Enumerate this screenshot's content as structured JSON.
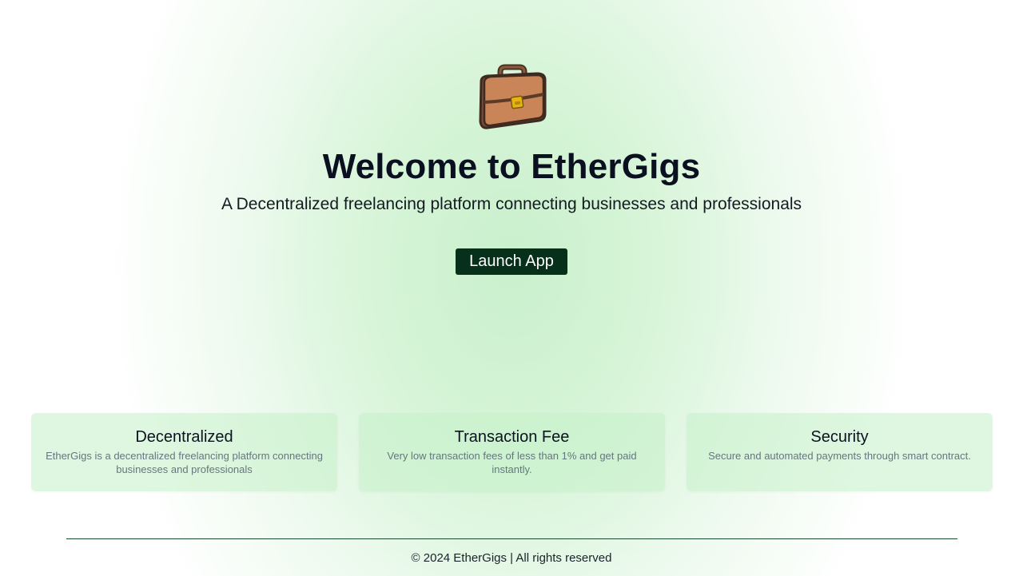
{
  "hero": {
    "logo_icon": "briefcase-icon",
    "title": "Welcome to EtherGigs",
    "subtitle": "A Decentralized freelancing platform connecting businesses and professionals",
    "launch_label": "Launch App"
  },
  "features": [
    {
      "title": "Decentralized",
      "text": "EtherGigs is a decentralized freelancing platform connecting businesses and professionals"
    },
    {
      "title": "Transaction Fee",
      "text": "Very low transaction fees of less than 1% and get paid instantly."
    },
    {
      "title": "Security",
      "text": "Secure and automated payments through smart contract."
    }
  ],
  "footer": {
    "text": "© 2024 EtherGigs | All rights reserved"
  },
  "colors": {
    "button_bg": "#06301a",
    "card_bg": "#c4f0c8",
    "divider": "#184a30",
    "title": "#0a1020"
  }
}
